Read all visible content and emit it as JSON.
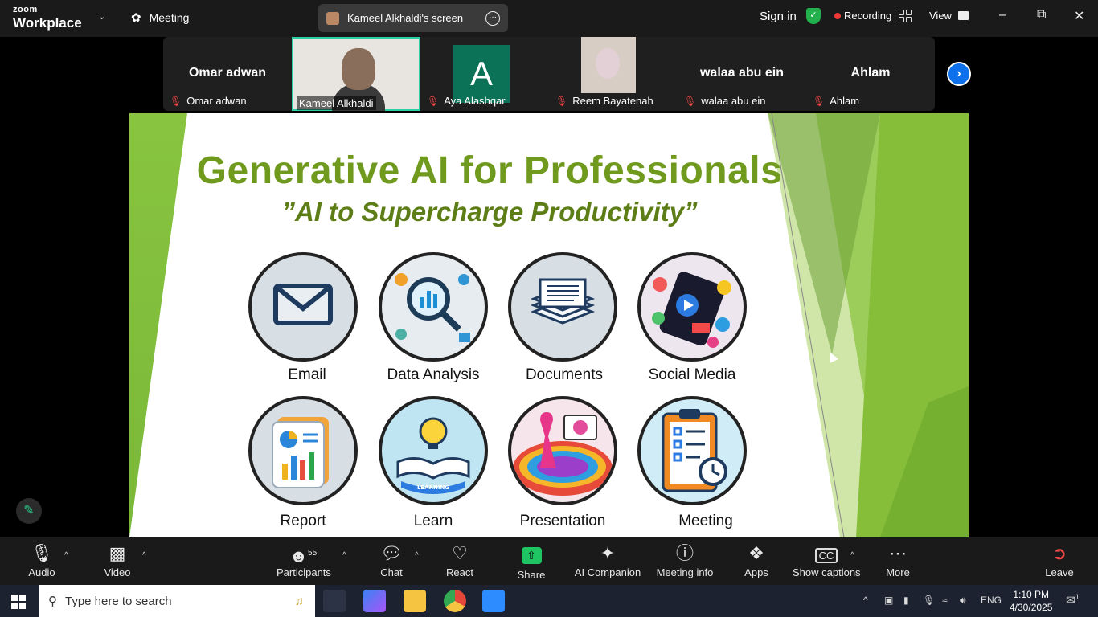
{
  "topbar": {
    "logo_line1": "zoom",
    "logo_line2": "Workplace",
    "meeting_label": "Meeting",
    "share_title": "Kameel Alkhaldi's screen",
    "signin": "Sign in",
    "recording": "Recording",
    "view": "View"
  },
  "participants_strip": [
    {
      "name": "Omar adwan",
      "big_name": "Omar adwan",
      "muted": true
    },
    {
      "name": "Kameel Alkhaldi",
      "big_name": "",
      "muted": false,
      "active": true
    },
    {
      "name": "Aya Alashqar",
      "big_name": "",
      "avatar_letter": "A",
      "muted": true
    },
    {
      "name": "Reem Bayatenah",
      "big_name": "",
      "muted": true
    },
    {
      "name": "walaa abu ein",
      "big_name": "walaa abu ein",
      "muted": true
    },
    {
      "name": "Ahlam",
      "big_name": "Ahlam",
      "muted": true
    }
  ],
  "slide": {
    "title": "Generative AI for Professionals",
    "subtitle": "”AI to Supercharge Productivity”",
    "items": [
      {
        "label": "Email",
        "icon": "envelope-icon"
      },
      {
        "label": "Data Analysis",
        "icon": "magnifier-chart-icon"
      },
      {
        "label": "Documents",
        "icon": "documents-stack-icon"
      },
      {
        "label": "Social Media",
        "icon": "social-media-icon"
      },
      {
        "label": "Report",
        "icon": "report-icon"
      },
      {
        "label": "Learn",
        "icon": "book-bulb-icon"
      },
      {
        "label": "Presentation",
        "icon": "presentation-icon"
      },
      {
        "label": "Meeting",
        "icon": "clipboard-clock-icon"
      }
    ],
    "learn_badge": "LEARNING"
  },
  "toolbar": {
    "audio": "Audio",
    "video": "Video",
    "participants": "Participants",
    "participants_count": "55",
    "chat": "Chat",
    "react": "React",
    "share": "Share",
    "ai_companion": "AI Companion",
    "meeting_info": "Meeting info",
    "apps": "Apps",
    "show_captions": "Show captions",
    "more": "More",
    "leave": "Leave"
  },
  "taskbar": {
    "search_placeholder": "Type here to search",
    "lang": "ENG",
    "time": "1:10 PM",
    "date": "4/30/2025",
    "notif_count": "1"
  },
  "colors": {
    "slide_title": "#6f9a1e",
    "slide_green": "#88c43f",
    "active_border": "#2ad0a3",
    "share_green": "#1fc463",
    "record_red": "#f03a3a"
  }
}
